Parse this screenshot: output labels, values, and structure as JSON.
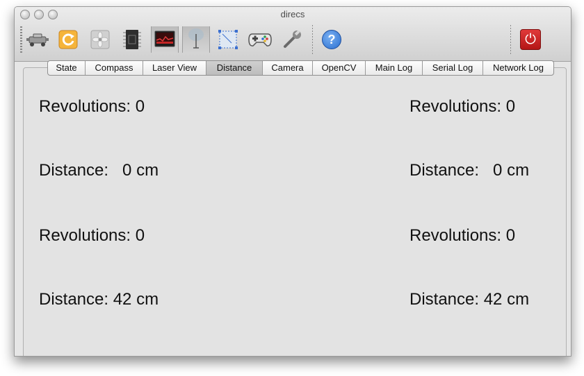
{
  "window": {
    "title": "direcs"
  },
  "toolbar": {
    "buttons": [
      {
        "name": "robot",
        "icon": "robot-icon"
      },
      {
        "name": "reset",
        "icon": "reset-icon"
      },
      {
        "name": "fan",
        "icon": "fan-icon"
      },
      {
        "name": "chip",
        "icon": "chip-icon"
      },
      {
        "name": "laser-view",
        "icon": "monitor-icon"
      },
      {
        "name": "sensor",
        "icon": "sensor-icon"
      },
      {
        "name": "select",
        "icon": "selection-icon"
      },
      {
        "name": "gamepad",
        "icon": "gamepad-icon"
      },
      {
        "name": "settings",
        "icon": "wrench-icon"
      },
      {
        "name": "help",
        "icon": "help-icon",
        "glyph": "?"
      },
      {
        "name": "power",
        "icon": "power-icon",
        "glyph": "⏻"
      }
    ]
  },
  "tabs": [
    {
      "label": "State"
    },
    {
      "label": "Compass"
    },
    {
      "label": "Laser View"
    },
    {
      "label": "Distance",
      "selected": true
    },
    {
      "label": "Camera"
    },
    {
      "label": "OpenCV"
    },
    {
      "label": "Main Log"
    },
    {
      "label": "Serial Log"
    },
    {
      "label": "Network Log"
    }
  ],
  "distance_panel": {
    "left": {
      "revolutions_1": "Revolutions: 0",
      "distance_1": "Distance:   0 cm",
      "revolutions_2": "Revolutions: 0",
      "distance_2": "Distance: 42 cm"
    },
    "right": {
      "revolutions_1": "Revolutions: 0",
      "distance_1": "Distance:   0 cm",
      "revolutions_2": "Revolutions: 0",
      "distance_2": "Distance: 42 cm"
    }
  },
  "colors": {
    "power": "#c62020",
    "help": "#2a6fd0",
    "reset": "#f2a22a"
  }
}
